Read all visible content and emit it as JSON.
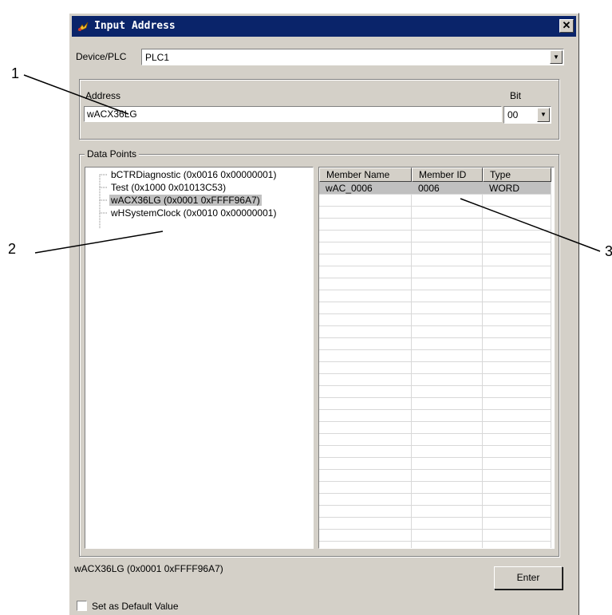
{
  "window": {
    "title": "Input Address",
    "close_glyph": "✕"
  },
  "device": {
    "label": "Device/PLC",
    "value": "PLC1"
  },
  "address": {
    "label": "Address",
    "value": "wACX36LG",
    "bit_label": "Bit",
    "bit_value": "00"
  },
  "data_points": {
    "label": "Data Points",
    "tree": [
      "bCTRDiagnostic (0x0016 0x00000001)",
      "Test (0x1000 0x01013C53)",
      "wACX36LG (0x0001 0xFFFF96A7)",
      "wHSystemClock (0x0010 0x00000001)"
    ],
    "selected_index": 2,
    "columns": [
      "Member Name",
      "Member ID",
      "Type"
    ],
    "rows": [
      [
        "wAC_0006",
        "0006",
        "WORD"
      ]
    ]
  },
  "status_text": "wACX36LG (0x0001 0xFFFF96A7)",
  "enter_label": "Enter",
  "default_checkbox": {
    "label": "Set as Default Value",
    "checked": false
  },
  "callouts": [
    "1",
    "2",
    "3"
  ]
}
